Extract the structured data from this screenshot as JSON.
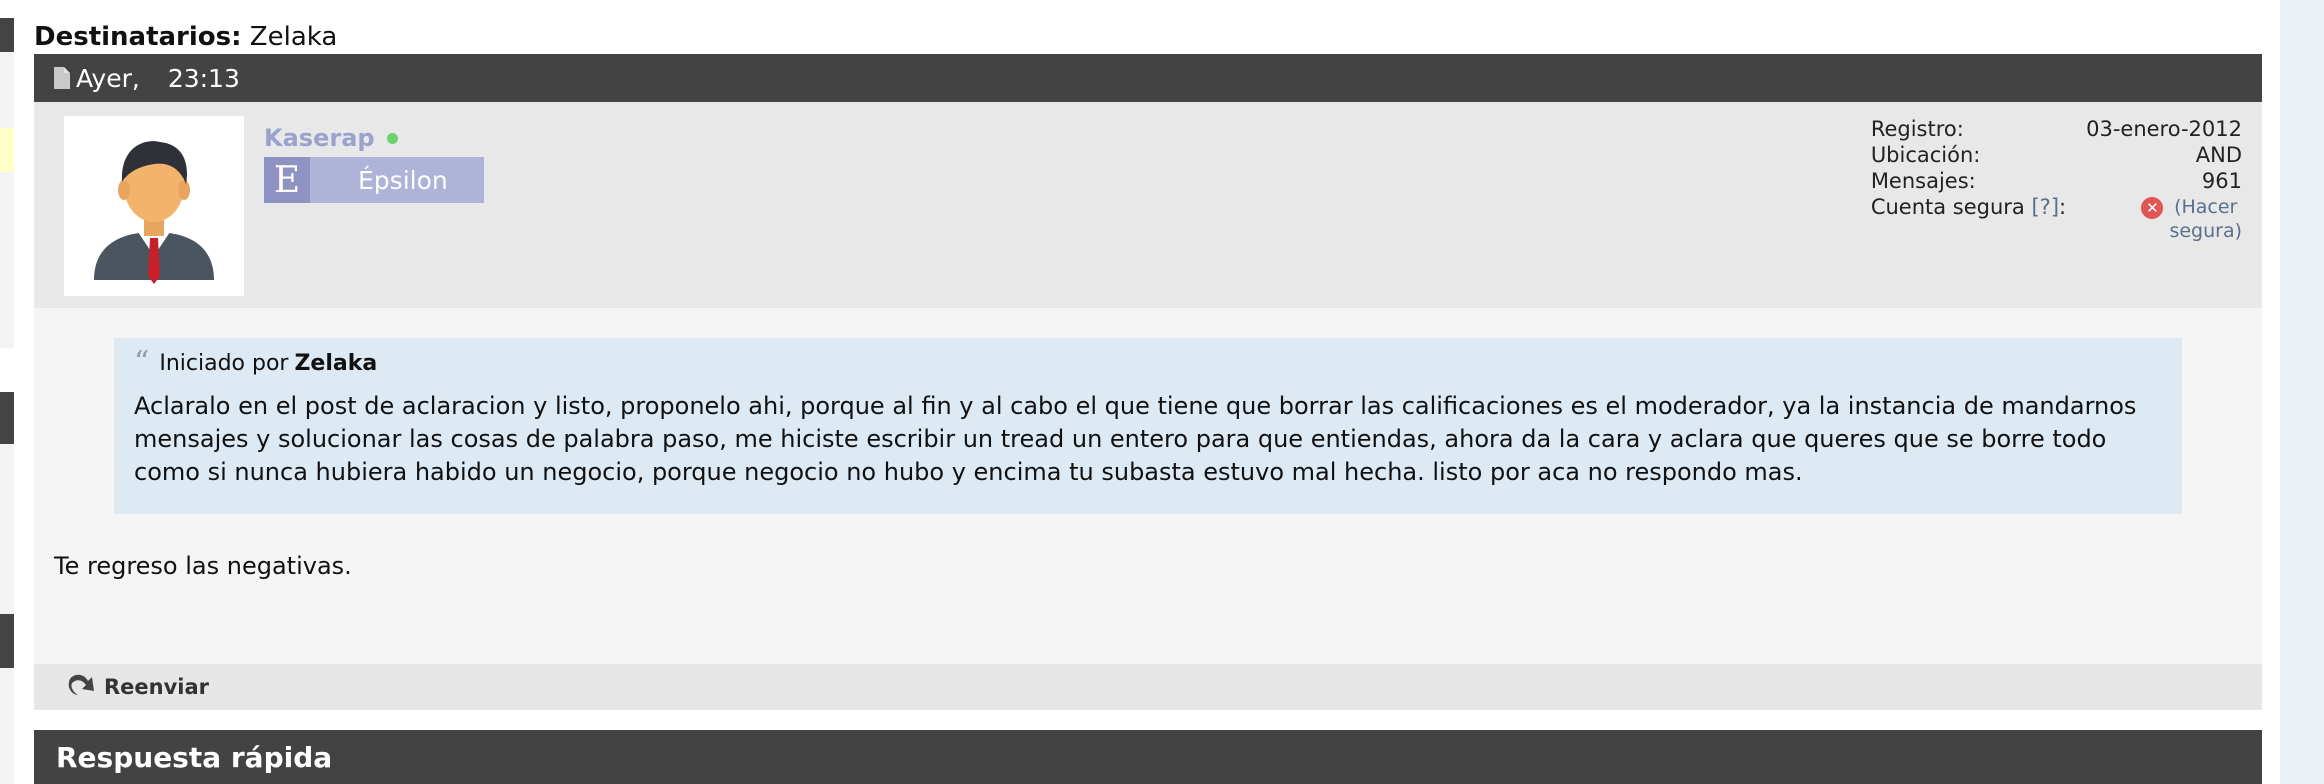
{
  "recipients": {
    "label": "Destinatarios:",
    "value": "Zelaka"
  },
  "post": {
    "day": "Ayer,",
    "time": "23:13"
  },
  "user": {
    "name": "Kaserap",
    "rank_letter": "E",
    "rank_name": "Épsilon",
    "info": {
      "registro_label": "Registro:",
      "registro_value": "03-enero-2012",
      "ubicacion_label": "Ubicación:",
      "ubicacion_value": "AND",
      "mensajes_label": "Mensajes:",
      "mensajes_value": "961",
      "cuenta_label": "Cuenta segura",
      "cuenta_help": "[?]",
      "cuenta_colon": ":",
      "hacer_segura_1": "(Hacer",
      "hacer_segura_2": "segura)"
    }
  },
  "quote": {
    "prefix": "Iniciado por",
    "author": "Zelaka",
    "text": "Aclaralo en el post de aclaracion y listo, proponelo ahi, porque al fin y al cabo el que tiene que borrar las calificaciones es el moderador, ya la instancia de mandarnos mensajes y solucionar las cosas de palabra paso, me hiciste escribir un tread un entero para que entiendas, ahora da la cara y aclara que queres que se borre todo como si nunca hubiera habido un negocio, porque negocio no hubo y encima tu subasta estuvo mal hecha. listo por aca no respondo mas."
  },
  "message": {
    "text": "Te regreso las negativas."
  },
  "actions": {
    "forward": "Reenviar"
  },
  "quick_reply": {
    "title": "Respuesta rápida"
  },
  "colors": {
    "header_bg": "#434343",
    "username": "#9aa3cc",
    "rank_bg": "#b0b3d8",
    "quote_bg": "#dde9f3",
    "online": "#6fd06f",
    "insecure": "#e05555"
  },
  "icons": {
    "post": "document-icon",
    "quote": "quote-icon",
    "status": "online-dot-icon",
    "secure": "x-circle-icon",
    "forward": "forward-arrow-icon"
  }
}
